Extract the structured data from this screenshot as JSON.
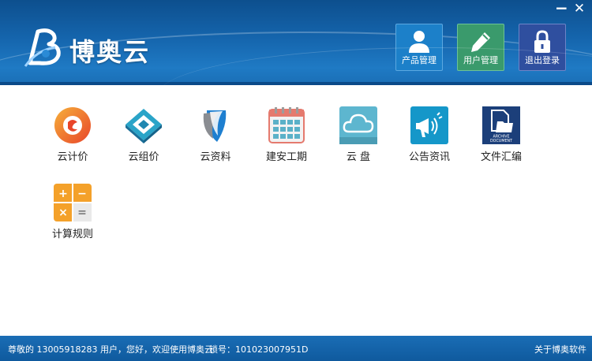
{
  "app": {
    "title": "博奥云"
  },
  "window": {
    "minimize": "−",
    "close": "✕"
  },
  "header_buttons": [
    {
      "label": "产品管理",
      "icon": "person-icon"
    },
    {
      "label": "用户管理",
      "icon": "pencil-icon"
    },
    {
      "label": "退出登录",
      "icon": "lock-icon"
    }
  ],
  "apps": [
    {
      "label": "云计价",
      "icon": "cloud-pricing-icon"
    },
    {
      "label": "云组价",
      "icon": "cloud-combined-pricing-icon"
    },
    {
      "label": "云资料",
      "icon": "cloud-documents-icon"
    },
    {
      "label": "建安工期",
      "icon": "calendar-icon"
    },
    {
      "label": "云 盘",
      "icon": "cloud-disk-icon"
    },
    {
      "label": "公告资讯",
      "icon": "megaphone-icon"
    },
    {
      "label": "文件汇编",
      "icon": "archive-document-icon",
      "icon_text": [
        "ARCHIVE",
        "DOCUMENT"
      ]
    },
    {
      "label": "计算规则",
      "icon": "calculator-icon",
      "icon_text": [
        "+",
        "−",
        "×",
        "="
      ]
    }
  ],
  "status": {
    "welcome": "尊敬的 13005918283 用户，您好，欢迎使用博奥云",
    "lock_no": "锁号：101023007951D",
    "about": "关于博奥软件"
  },
  "colors": {
    "header": "#1565ad",
    "statusbar": "#0f5a9e",
    "product_button": "#1c80c9",
    "user_button": "#3a9a6c",
    "logout_button": "#2f4f9f"
  }
}
